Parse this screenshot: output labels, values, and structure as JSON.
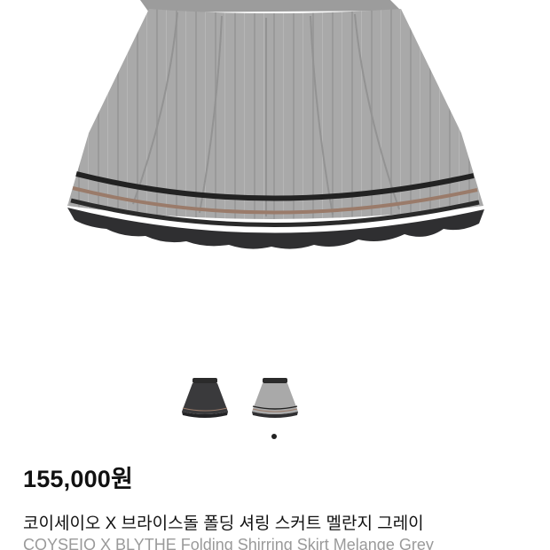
{
  "product": {
    "price": "155,000원",
    "title_ko": "코이세이오 X 브라이스돌 폴딩 셔링 스커트 멜란지 그레이",
    "title_en": "COYSEIO X BLYTHE Folding Shirring Skirt Melange Grey"
  },
  "gallery": {
    "hero_image": "skirt-grey-icon",
    "thumbnails": [
      {
        "color_name": "charcoal",
        "icon": "skirt-charcoal-icon"
      },
      {
        "color_name": "grey",
        "icon": "skirt-grey-icon"
      }
    ],
    "active_index": 1
  },
  "colors": {
    "grey": "#a9a9a9",
    "charcoal": "#3a3a3c",
    "stripe_brown": "#9a7b6a",
    "ruffle": "#2f2f31",
    "price_text": "#111111",
    "subtitle_text": "#9a9a9a"
  }
}
